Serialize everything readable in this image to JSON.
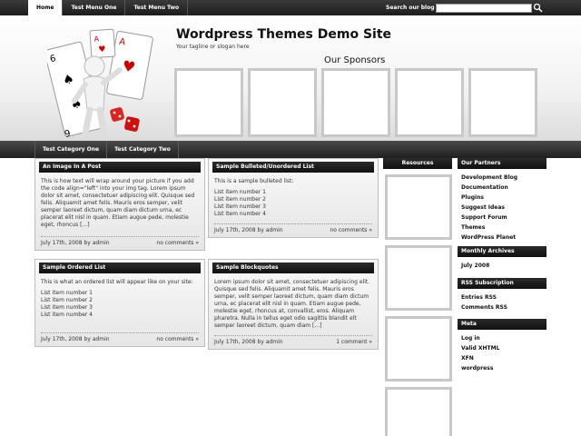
{
  "topnav": {
    "items": [
      "Home",
      "Test Menu One",
      "Test Menu Two"
    ],
    "search_label": "Search our blog",
    "search_value": ""
  },
  "header": {
    "title": "Wordpress Themes Demo Site",
    "tagline": "Your tagline or slogan here",
    "sponsors_title": "Our Sponsors"
  },
  "catnav": {
    "items": [
      "Test Category One",
      "Test Category Two"
    ]
  },
  "posts": [
    {
      "title": "An Image In A Post",
      "paragraphs": [
        "This is how text will wrap around your picture if you add the code align=\"left\" into your img tag. Lorem ipsum dolor sit amet, consectetuer adipiscing elit. Quisque sed felis. Aliquamit amet felis. Mauris eros semper, velit semper laoreet dictum, quam diam dictum urna, ec placerat elit nisl in quam. Etiam augue pede, molestie eget, rhoncus [...]"
      ],
      "date": "July 17th, 2008 by admin",
      "comments": "no comments »"
    },
    {
      "title": "Sample Bulleted/Unordered List",
      "paragraphs": [
        "This is a sample bulleted list:"
      ],
      "list": [
        "List item number 1",
        "List item number 2",
        "List item number 3",
        "List item number 4"
      ],
      "date": "July 17th, 2008 by admin",
      "comments": "no comments »"
    },
    {
      "title": "Sample Ordered List",
      "paragraphs": [
        "This is what an ordered list will appear like on your site:"
      ],
      "list": [
        "List item number 1",
        "List item number 2",
        "List item number 3",
        "List item number 4"
      ],
      "date": "July 17th, 2008 by admin",
      "comments": "no comments »"
    },
    {
      "title": "Sample Blockquotes",
      "paragraphs": [
        "Lorem ipsum dolor sit amet, consectetuer adipiscing elit. Quisque sed felis. Aliquamit amet felis. Mauris eros semper, velit semper laoreet dictum, quam diam dictum urna, ec placerat elit nisl in quam. Etiam augue pede, molestie eget, rhoncus at, convallist, eros. Aliquam pharetra. Nulla in tellus eget odio sagittis blandit elt semper laoreet dictum, quam diam [...]"
      ],
      "date": "July 17th, 2008 by admin",
      "comments": "1 comment »"
    }
  ],
  "resources": {
    "title": "Resources"
  },
  "widgets": [
    {
      "title": "Our Partners",
      "items": [
        "Development Blog",
        "Documentation",
        "Plugins",
        "Suggest Ideas",
        "Support Forum",
        "Themes",
        "WordPress Planet"
      ]
    },
    {
      "title": "Monthly Archives",
      "items": [
        "July 2008"
      ]
    },
    {
      "title": "RSS Subscription",
      "items": [
        "Entries RSS",
        "Comments RSS"
      ]
    },
    {
      "title": "Meta",
      "items": [
        "Log in",
        "Valid XHTML",
        "XFN",
        "wordpress"
      ]
    }
  ],
  "colors": {
    "bar_dark": "#1c1c1c",
    "box_border": "#c8c8c8"
  }
}
